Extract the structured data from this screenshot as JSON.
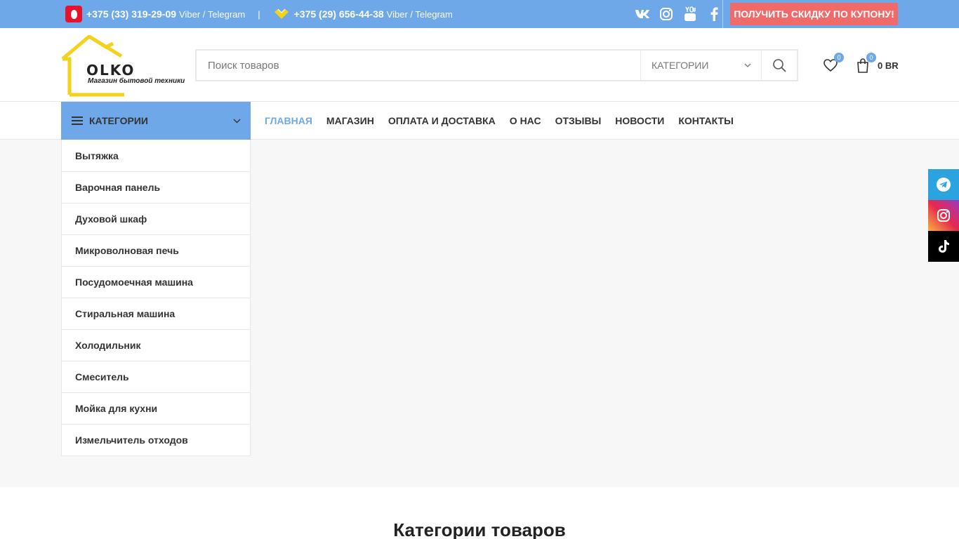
{
  "topbar": {
    "phone1": "+375 (33) 319-29-09",
    "phone1_note": "Viber / Telegram",
    "separator": "|",
    "phone2": "+375 (29) 656-44-38",
    "phone2_note": "Viber / Telegram",
    "social_icons": [
      "vk-icon",
      "instagram-icon",
      "youtube-icon",
      "facebook-icon"
    ],
    "coupon_label": "ПОЛУЧИТЬ СКИДКУ ПО КУПОНУ!"
  },
  "header": {
    "logo_brand": "OLKO",
    "logo_tagline": "Магазин бытовой техники",
    "search_placeholder": "Поиск товаров",
    "category_select": "КАТЕГОРИИ",
    "wishlist_count": "0",
    "cart_count": "0",
    "cart_total": "0 BR"
  },
  "nav": {
    "categories_label": "КАТЕГОРИИ",
    "items": [
      "ГЛАВНАЯ",
      "МАГАЗИН",
      "ОПЛАТА И ДОСТАВКА",
      "О НАС",
      "ОТЗЫВЫ",
      "НОВОСТИ",
      "КОНТАКТЫ"
    ],
    "active_index": 0
  },
  "categories": [
    "Вытяжка",
    "Варочная панель",
    "Духовой шкаф",
    "Микроволновая печь",
    "Посудомоечная машина",
    "Стиральная машина",
    "Холодильник",
    "Смеситель",
    "Мойка для кухни",
    "Измельчитель отходов"
  ],
  "section": {
    "title": "Категории товаров"
  },
  "floating_social": [
    "telegram-icon",
    "instagram-icon",
    "tiktok-icon"
  ],
  "colors": {
    "accent": "#6fa8e8",
    "coupon": "#f06a6a",
    "logo_yellow": "#f2d21b"
  }
}
